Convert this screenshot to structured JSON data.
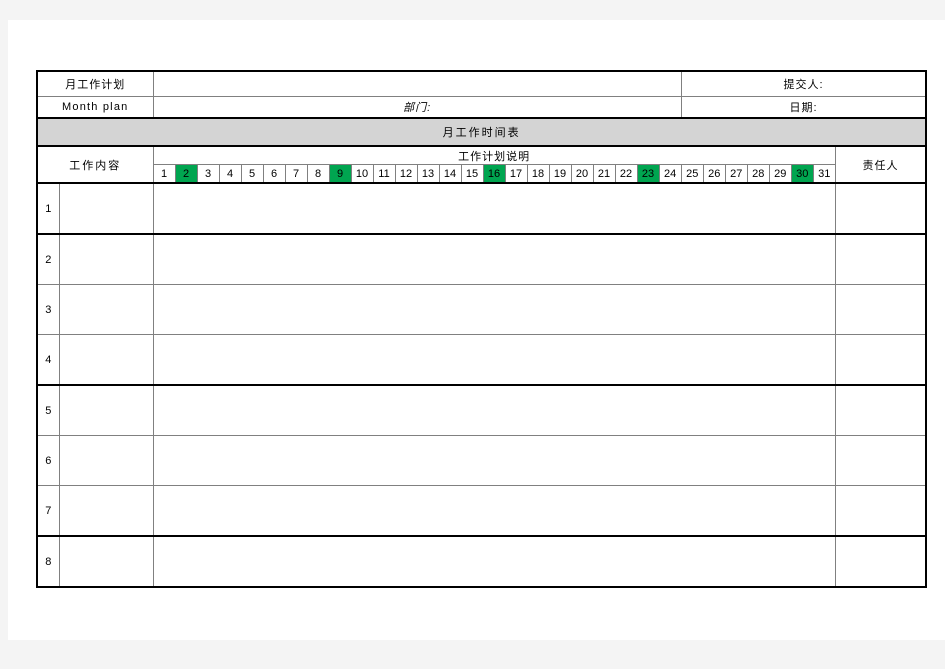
{
  "document": {
    "title_cn": "月工作计划",
    "title_en": "Month plan",
    "department_label": "部门:",
    "submitter_label": "提交人:",
    "date_label": "日期:",
    "banner_title": "月工作时间表"
  },
  "table": {
    "columns": {
      "work_content": "工作内容",
      "plan_description": "工作计划说明",
      "responsible_person": "责任人"
    },
    "days": [
      {
        "n": "1",
        "weekend": false
      },
      {
        "n": "2",
        "weekend": true
      },
      {
        "n": "3",
        "weekend": false
      },
      {
        "n": "4",
        "weekend": false
      },
      {
        "n": "5",
        "weekend": false
      },
      {
        "n": "6",
        "weekend": false
      },
      {
        "n": "7",
        "weekend": false
      },
      {
        "n": "8",
        "weekend": false
      },
      {
        "n": "9",
        "weekend": true
      },
      {
        "n": "10",
        "weekend": false
      },
      {
        "n": "11",
        "weekend": false
      },
      {
        "n": "12",
        "weekend": false
      },
      {
        "n": "13",
        "weekend": false
      },
      {
        "n": "14",
        "weekend": false
      },
      {
        "n": "15",
        "weekend": false
      },
      {
        "n": "16",
        "weekend": true
      },
      {
        "n": "17",
        "weekend": false
      },
      {
        "n": "18",
        "weekend": false
      },
      {
        "n": "19",
        "weekend": false
      },
      {
        "n": "20",
        "weekend": false
      },
      {
        "n": "21",
        "weekend": false
      },
      {
        "n": "22",
        "weekend": false
      },
      {
        "n": "23",
        "weekend": true
      },
      {
        "n": "24",
        "weekend": false
      },
      {
        "n": "25",
        "weekend": false
      },
      {
        "n": "26",
        "weekend": false
      },
      {
        "n": "27",
        "weekend": false
      },
      {
        "n": "28",
        "weekend": false
      },
      {
        "n": "29",
        "weekend": false
      },
      {
        "n": "30",
        "weekend": true
      },
      {
        "n": "31",
        "weekend": false
      }
    ],
    "rows": [
      {
        "index": "1",
        "work_content": "",
        "responsible_person": ""
      },
      {
        "index": "2",
        "work_content": "",
        "responsible_person": ""
      },
      {
        "index": "3",
        "work_content": "",
        "responsible_person": ""
      },
      {
        "index": "4",
        "work_content": "",
        "responsible_person": ""
      },
      {
        "index": "5",
        "work_content": "",
        "responsible_person": ""
      },
      {
        "index": "6",
        "work_content": "",
        "responsible_person": ""
      },
      {
        "index": "7",
        "work_content": "",
        "responsible_person": ""
      },
      {
        "index": "8",
        "work_content": "",
        "responsible_person": ""
      }
    ],
    "field_values": {
      "title_field": "",
      "department_field": "",
      "submitter_field": "",
      "date_field": ""
    }
  },
  "colors": {
    "weekend_green": "#00a550",
    "banner_gray": "#d4d4d4",
    "grid_line": "#808080",
    "heavy_line": "#000000"
  }
}
